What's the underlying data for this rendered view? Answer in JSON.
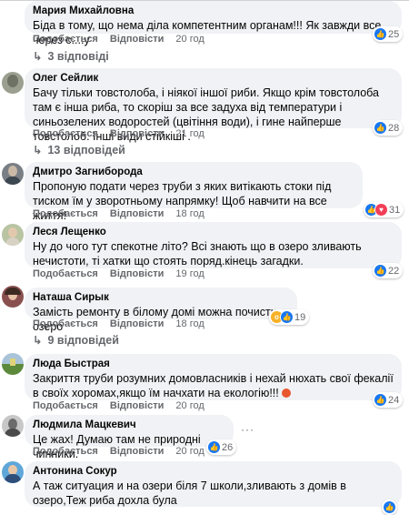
{
  "actions": {
    "like": "Подобається",
    "reply": "Відповісти"
  },
  "comments": [
    {
      "name": "Мария Михайловна",
      "text": "Біда в тому, що нема діла компетентним органам!!! Як завжди все через с....у",
      "time": "20 год",
      "reactions": "25",
      "reaction_types": [
        "like"
      ],
      "replies": "3 відповіді"
    },
    {
      "name": "Олег Сейлик",
      "text": "Бачу тільки товстолоба, і ніякої іншої риби. Якщо крім товстолоба там є інша риба, то скоріш за все задуха від температури і синьозелених водоростей (цвітіння води), і гине найперше товстолоб. Інші види стійкіші .",
      "time": "21 год",
      "reactions": "28",
      "reaction_types": [
        "like"
      ],
      "replies": "13 відповідей"
    },
    {
      "name": "Дмитро Загниборода",
      "text": "Пропоную подати через труби з яких витікають стоки під тиском їм у зворотньому напрямку! Щоб навчити на все життя!",
      "time": "18 год",
      "reactions": "31",
      "reaction_types": [
        "like",
        "love"
      ]
    },
    {
      "name": "Леся Лещенко",
      "text": "Ну до чого тут спекотне літо? Всі знають що в озеро зливають нечистоти, ті хатки що стоять поряд.кінець загадки.",
      "time": "19 год",
      "reactions": "22",
      "reaction_types": [
        "like"
      ]
    },
    {
      "name": "Наташа Сирык",
      "text": "Замість ремонту в білому домі можна почистити озеро",
      "time": "18 год",
      "reactions": "19",
      "reaction_types": [
        "wow",
        "like"
      ],
      "replies": "9 відповідей"
    },
    {
      "name": "Люда Быстрая",
      "text": "Закриття труби розумних домовласників і нехай нюхать свої фекалії в своїх хоромах,якщо їм начхати на екологію!!!",
      "time": "20 год",
      "reactions": "24",
      "reaction_types": [
        "like"
      ]
    },
    {
      "name": "Людмила Мацкевич",
      "text": "Це жах! Думаю там не природні чинники.",
      "time": "20 год",
      "reactions": "26",
      "reaction_types": [
        "like"
      ]
    },
    {
      "name": "Антонина Сокур",
      "text": "А таж ситуация и на озери біля 7 школи,зливають з домів в озеро,Теж риба дохла була",
      "time": "",
      "reactions": "",
      "reaction_types": [
        "like"
      ]
    }
  ],
  "colors": {
    "accent": "#1877f2",
    "love": "#f33e58",
    "wow": "#f7b125"
  }
}
